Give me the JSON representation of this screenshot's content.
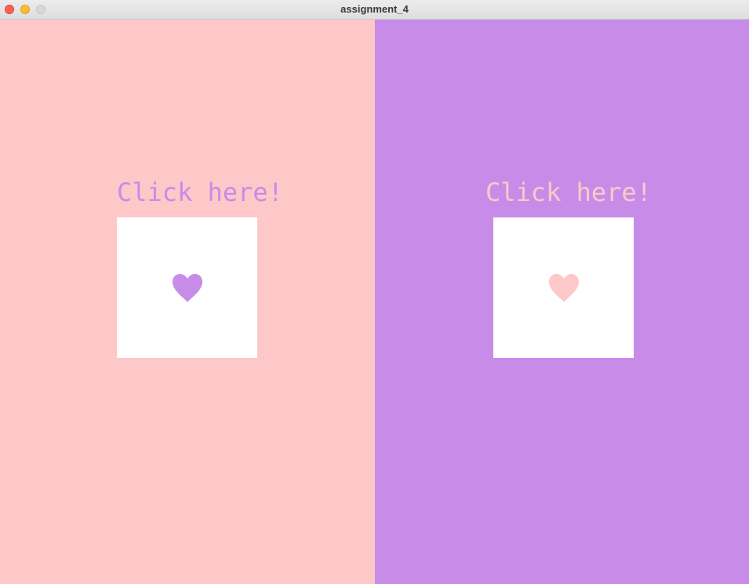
{
  "window": {
    "title": "assignment_4"
  },
  "panels": [
    {
      "prompt": "Click here!",
      "background": "#fec8c9",
      "text_color": "#c78ce8",
      "heart_color": "#c78ce8",
      "heart_icon": "heart-icon"
    },
    {
      "prompt": "Click here!",
      "background": "#c78ce8",
      "text_color": "#fec8c9",
      "heart_color": "#fec8c9",
      "heart_icon": "heart-icon"
    }
  ],
  "colors": {
    "card": "#ffffff"
  }
}
